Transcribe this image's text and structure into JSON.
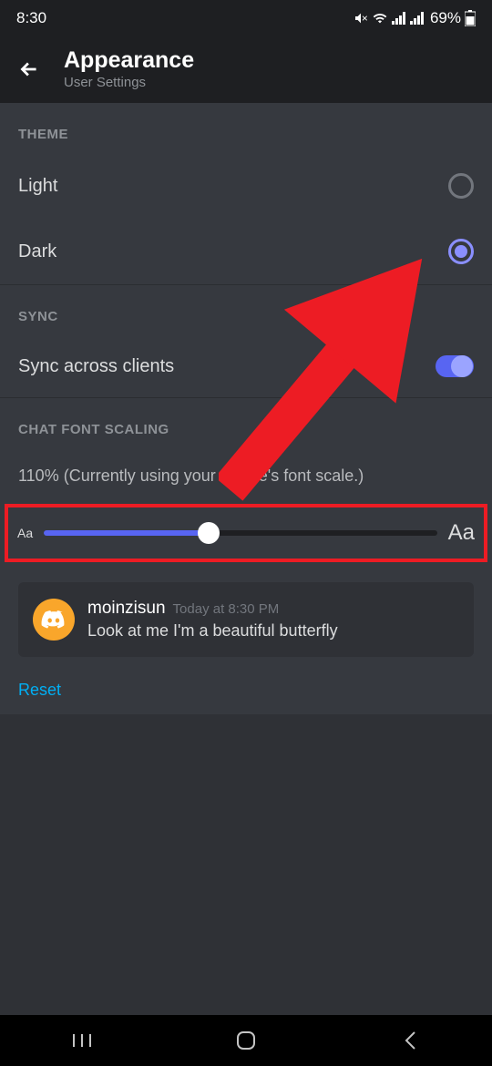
{
  "status_bar": {
    "time": "8:30",
    "battery": "69%"
  },
  "header": {
    "title": "Appearance",
    "subtitle": "User Settings"
  },
  "theme": {
    "section_label": "THEME",
    "option_light": "Light",
    "option_dark": "Dark"
  },
  "sync": {
    "section_label": "SYNC",
    "label": "Sync across clients"
  },
  "font_scaling": {
    "section_label": "CHAT FONT SCALING",
    "current_text": "110% (Currently using your device's font scale.)",
    "small_label": "Aa",
    "big_label": "Aa"
  },
  "preview": {
    "username": "moinzisun",
    "timestamp": "Today at 8:30 PM",
    "message": "Look at me I'm a beautiful butterfly"
  },
  "reset": {
    "label": "Reset"
  }
}
